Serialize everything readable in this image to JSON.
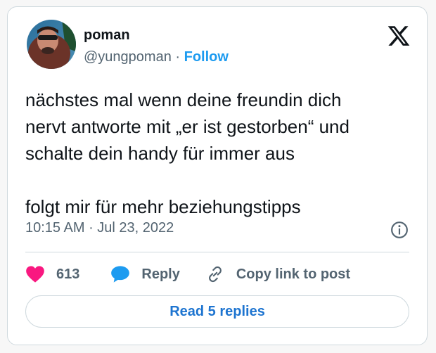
{
  "author": {
    "display_name": "poman",
    "handle": "@yungpoman",
    "separator": " · ",
    "follow_label": "Follow"
  },
  "tweet": {
    "text": "nächstes mal wenn deine freundin dich\nnervt antworte mit „er ist gestorben“ und\nschalte dein handy für immer aus\n\nfolgt mir für mehr beziehungstipps",
    "time": "10:15 AM",
    "date_separator": " · ",
    "date": "Jul 23, 2022"
  },
  "actions": {
    "like_count": "613",
    "reply_label": "Reply",
    "copy_label": "Copy link to post"
  },
  "read_replies_label": "Read 5 replies",
  "colors": {
    "accent": "#1d9bf0",
    "heart": "#f91880",
    "text": "#0f1419",
    "muted": "#536471"
  }
}
